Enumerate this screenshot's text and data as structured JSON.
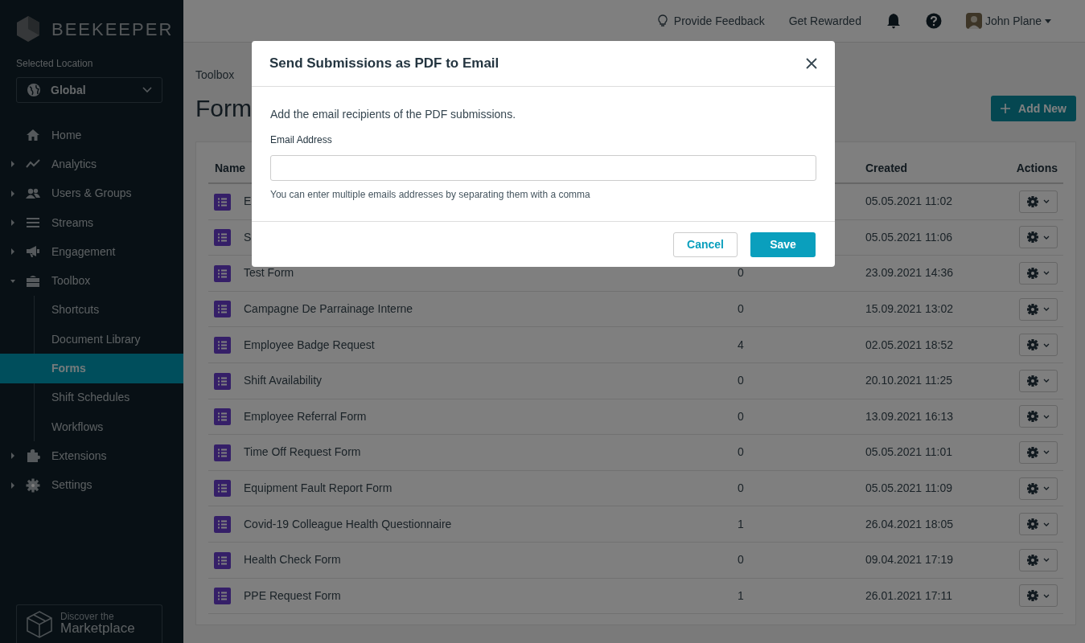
{
  "sidebar": {
    "brand": "BEEKEEPER",
    "location_label": "Selected Location",
    "location": "Global",
    "nav": [
      {
        "label": "Home",
        "selected": false
      },
      {
        "label": "Analytics",
        "selected": false,
        "expanded": false
      },
      {
        "label": "Users & Groups",
        "selected": false,
        "expanded": false
      },
      {
        "label": "Streams",
        "selected": false,
        "expanded": false
      },
      {
        "label": "Engagement",
        "selected": false,
        "expanded": false
      },
      {
        "label": "Toolbox",
        "selected": false,
        "expanded": true,
        "children": [
          {
            "label": "Shortcuts",
            "selected": false
          },
          {
            "label": "Document Library",
            "selected": false
          },
          {
            "label": "Forms",
            "selected": true
          },
          {
            "label": "Shift Schedules",
            "selected": false
          },
          {
            "label": "Workflows",
            "selected": false
          }
        ]
      },
      {
        "label": "Extensions",
        "selected": false,
        "expanded": false
      },
      {
        "label": "Settings",
        "selected": false,
        "expanded": false
      }
    ],
    "marketplace": {
      "line_1": "Discover the",
      "line_2": "Marketplace"
    }
  },
  "header": {
    "feedback": "Provide Feedback",
    "rewarded": "Get Rewarded",
    "user": "John Plane"
  },
  "page": {
    "breadcrumb": "Toolbox",
    "title": "Form",
    "add_button": "Add New"
  },
  "table": {
    "columns": [
      "Name",
      "Created",
      "Actions"
    ],
    "rows": [
      {
        "name": "E",
        "created": "05.05.2021 11:02"
      },
      {
        "name": "S",
        "created": "05.05.2021 11:06"
      },
      {
        "name": "Test Form",
        "count": "0",
        "created": "23.09.2021 14:36"
      },
      {
        "name": "Campagne De Parrainage Interne",
        "count": "0",
        "created": "15.09.2021 13:02"
      },
      {
        "name": "Employee Badge Request",
        "count": "4",
        "created": "02.05.2021 18:52"
      },
      {
        "name": "Shift Availability",
        "count": "0",
        "created": "20.10.2021 11:25"
      },
      {
        "name": "Employee Referral Form",
        "count": "0",
        "created": "13.09.2021 16:13"
      },
      {
        "name": "Time Off Request Form",
        "count": "0",
        "created": "05.05.2021 11:01"
      },
      {
        "name": "Equipment Fault Report Form",
        "count": "0",
        "created": "05.05.2021 11:09"
      },
      {
        "name": "Covid-19 Colleague Health Questionnaire",
        "count": "1",
        "created": "26.04.2021 18:05"
      },
      {
        "name": "Health Check Form",
        "count": "0",
        "created": "09.04.2021 17:19"
      },
      {
        "name": "PPE Request Form",
        "count": "1",
        "created": "26.01.2021 17:11"
      }
    ]
  },
  "modal": {
    "title": "Send Submissions as PDF to Email",
    "intro": "Add the email recipients of the PDF submissions.",
    "field_label": "Email Address",
    "help": "You can enter multiple emails addresses by separating them with a comma",
    "cancel": "Cancel",
    "save": "Save"
  }
}
